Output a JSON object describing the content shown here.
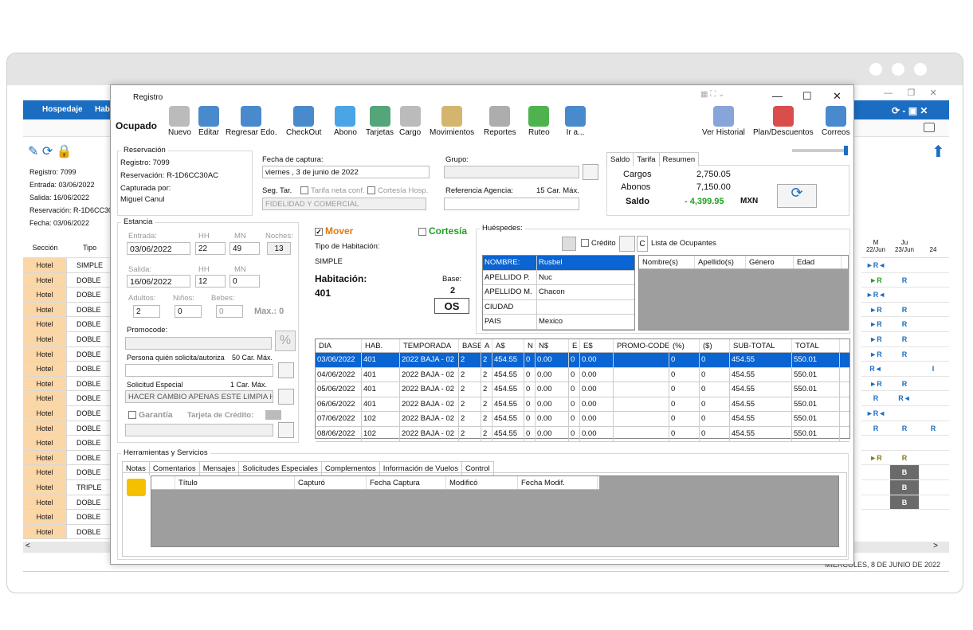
{
  "background_app": {
    "menu": [
      "Hospedaje",
      "Habi"
    ],
    "info": [
      "Registro: 7099",
      "Entrada: 03/06/2022",
      "Salida: 16/06/2022",
      "Reservación: R-1D6CC30",
      "Fecha: 03/06/2022"
    ],
    "grid_headers": [
      "Sección",
      "Tipo"
    ],
    "rows": [
      {
        "sec": "Hotel",
        "tipo": "SIMPLE"
      },
      {
        "sec": "Hotel",
        "tipo": "DOBLE"
      },
      {
        "sec": "Hotel",
        "tipo": "DOBLE"
      },
      {
        "sec": "Hotel",
        "tipo": "DOBLE"
      },
      {
        "sec": "Hotel",
        "tipo": "DOBLE"
      },
      {
        "sec": "Hotel",
        "tipo": "DOBLE"
      },
      {
        "sec": "Hotel",
        "tipo": "DOBLE"
      },
      {
        "sec": "Hotel",
        "tipo": "DOBLE"
      },
      {
        "sec": "Hotel",
        "tipo": "DOBLE"
      },
      {
        "sec": "Hotel",
        "tipo": "DOBLE"
      },
      {
        "sec": "Hotel",
        "tipo": "DOBLE"
      },
      {
        "sec": "Hotel",
        "tipo": "DOBLE"
      },
      {
        "sec": "Hotel",
        "tipo": "DOBLE"
      },
      {
        "sec": "Hotel",
        "tipo": "DOBLE"
      },
      {
        "sec": "Hotel",
        "tipo": "DOBLE"
      },
      {
        "sec": "Hotel",
        "tipo": "TRIPLE"
      },
      {
        "sec": "Hotel",
        "tipo": "DOBLE"
      },
      {
        "sec": "Hotel",
        "tipo": "DOBLE"
      },
      {
        "sec": "Hotel",
        "tipo": "DOBLE"
      }
    ],
    "right_headers": [
      {
        "d": "M",
        "n": "22/Jun"
      },
      {
        "d": "Ju",
        "n": "23/Jun"
      },
      {
        "d": "",
        "n": "24"
      }
    ],
    "right_rows": [
      [
        "►R◄",
        "",
        ""
      ],
      [
        "►R",
        "R",
        ""
      ],
      [
        "►R◄",
        "",
        ""
      ],
      [
        "►R",
        "R",
        ""
      ],
      [
        "►R",
        "R",
        ""
      ],
      [
        "►R",
        "R",
        ""
      ],
      [
        "►R",
        "R",
        ""
      ],
      [
        "R◄",
        "",
        "I"
      ],
      [
        "►R",
        "R",
        ""
      ],
      [
        "R",
        "R◄",
        ""
      ],
      [
        "►R◄",
        "",
        ""
      ],
      [
        "R",
        "R",
        "R"
      ],
      [
        "",
        "",
        ""
      ],
      [
        "►R",
        "R",
        ""
      ],
      [
        "",
        "B",
        ""
      ],
      [
        "",
        "B",
        ""
      ],
      [
        "",
        "B",
        ""
      ]
    ],
    "status": "MIÉRCOLES, 8 DE JUNIO DE 2022"
  },
  "window": {
    "title": "Registro",
    "status": "Ocupado",
    "toolbar": [
      "Nuevo",
      "Editar",
      "Regresar Edo.",
      "CheckOut",
      "Abono",
      "Tarjetas",
      "Cargo",
      "Movimientos",
      "Reportes",
      "Ruteo",
      "Ir a...",
      "Ver Historial",
      "Plan/Descuentos",
      "Correos"
    ],
    "reservacion": {
      "label": "Reservación",
      "registro": "Registro:  7099",
      "reservacion": "Reservación: R-1D6CC30AC",
      "capturada_label": "Capturada por:",
      "capturada": "Miguel Canul"
    },
    "fecha_captura": {
      "label": "Fecha de captura:",
      "value": "viernes ,  3 de    junio    de 2022"
    },
    "seg_tar": "Seg. Tar.",
    "tarifa_neta": "Tarifa neta conf.",
    "cortesia_hosp": "Cortesía Hosp.",
    "segmento": "FIDELIDAD Y COMERCIAL",
    "grupo_label": "Grupo:",
    "ref_agencia": "Referencia Agencia:",
    "car_max_15": "15 Car. Máx.",
    "saldo_tabs": [
      "Saldo",
      "Tarifa",
      "Resumen"
    ],
    "cargos_label": "Cargos",
    "cargos": "2,750.05",
    "abonos_label": "Abonos",
    "abonos": "7,150.00",
    "saldo_label": "Saldo",
    "saldo": "- 4,399.95",
    "moneda": "MXN",
    "estancia": {
      "label": "Estancia",
      "entrada_label": "Entrada:",
      "hh": "HH",
      "mn": "MN",
      "noches_label": "Noches:",
      "entrada": "03/06/2022",
      "ent_hh": "22",
      "ent_mn": "49",
      "noches": "13",
      "salida_label": "Salida:",
      "salida": "16/06/2022",
      "sal_hh": "12",
      "sal_mn": "0",
      "adultos_label": "Adultos:",
      "ninos_label": "Niños:",
      "bebes_label": "Bebes:",
      "adultos": "2",
      "ninos": "0",
      "bebes": "0",
      "max": "Max.: 0",
      "promocode": "Promocode:",
      "persona": "Persona quién solicita/autoriza",
      "car50": "50 Car. Máx.",
      "solicitud": "Solicitud Especial",
      "car1": "1 Car. Máx.",
      "solicitud_val": "HACER CAMBIO APENAS ESTE LIMPIA HA",
      "garantia": "Garantía",
      "tarjeta": "Tarjeta de Crédito:"
    },
    "mover": "Mover",
    "cortesia": "Cortesía",
    "tipo_hab_label": "Tipo de Habitación:",
    "tipo_hab": "SIMPLE",
    "habitacion_label": "Habitación:",
    "habitacion": "401",
    "base_label": "Base:",
    "base": "2",
    "os": "OS",
    "huespedes_label": "Huéspedes:",
    "credito": "Crédito",
    "c": "C",
    "lista_ocupantes": "Lista de Ocupantes",
    "guest": [
      {
        "k": "NOMBRE:",
        "v": "Rusbel"
      },
      {
        "k": "APELLIDO P.",
        "v": "Nuc"
      },
      {
        "k": "APELLIDO M.",
        "v": "Chacon"
      },
      {
        "k": "CIUDAD",
        "v": ""
      },
      {
        "k": "PAIS",
        "v": "Mexico"
      }
    ],
    "ocupantes_headers": [
      "Nombre(s)",
      "Apellido(s)",
      "Género",
      "Edad"
    ],
    "tarifas_headers": [
      "DIA",
      "HAB.",
      "TEMPORADA",
      "BASE",
      "A",
      "A$",
      "N",
      "N$",
      "E",
      "E$",
      "PROMO-CODE",
      "(%)",
      "($)",
      "SUB-TOTAL",
      "TOTAL"
    ],
    "tarifas": [
      [
        "03/06/2022",
        "401",
        "2022 BAJA - 02",
        "2",
        "2",
        "454.55",
        "0",
        "0.00",
        "0",
        "0.00",
        "",
        "0",
        "0",
        "454.55",
        "550.01"
      ],
      [
        "04/06/2022",
        "401",
        "2022 BAJA - 02",
        "2",
        "2",
        "454.55",
        "0",
        "0.00",
        "0",
        "0.00",
        "",
        "0",
        "0",
        "454.55",
        "550.01"
      ],
      [
        "05/06/2022",
        "401",
        "2022 BAJA - 02",
        "2",
        "2",
        "454.55",
        "0",
        "0.00",
        "0",
        "0.00",
        "",
        "0",
        "0",
        "454.55",
        "550.01"
      ],
      [
        "06/06/2022",
        "401",
        "2022 BAJA - 02",
        "2",
        "2",
        "454.55",
        "0",
        "0.00",
        "0",
        "0.00",
        "",
        "0",
        "0",
        "454.55",
        "550.01"
      ],
      [
        "07/06/2022",
        "102",
        "2022 BAJA - 02",
        "2",
        "2",
        "454.55",
        "0",
        "0.00",
        "0",
        "0.00",
        "",
        "0",
        "0",
        "454.55",
        "550.01"
      ],
      [
        "08/06/2022",
        "102",
        "2022 BAJA - 02",
        "2",
        "2",
        "454.55",
        "0",
        "0.00",
        "0",
        "0.00",
        "",
        "0",
        "0",
        "454.55",
        "550.01"
      ]
    ],
    "herramientas": "Herramientas y Servicios",
    "tools_tabs": [
      "Notas",
      "Comentarios",
      "Mensajes",
      "Solicitudes Especiales",
      "Complementos",
      "Información de Vuelos",
      "Control"
    ],
    "notas_headers": [
      "Título",
      "Capturó",
      "Fecha Captura",
      "Modificó",
      "Fecha Modif."
    ]
  }
}
